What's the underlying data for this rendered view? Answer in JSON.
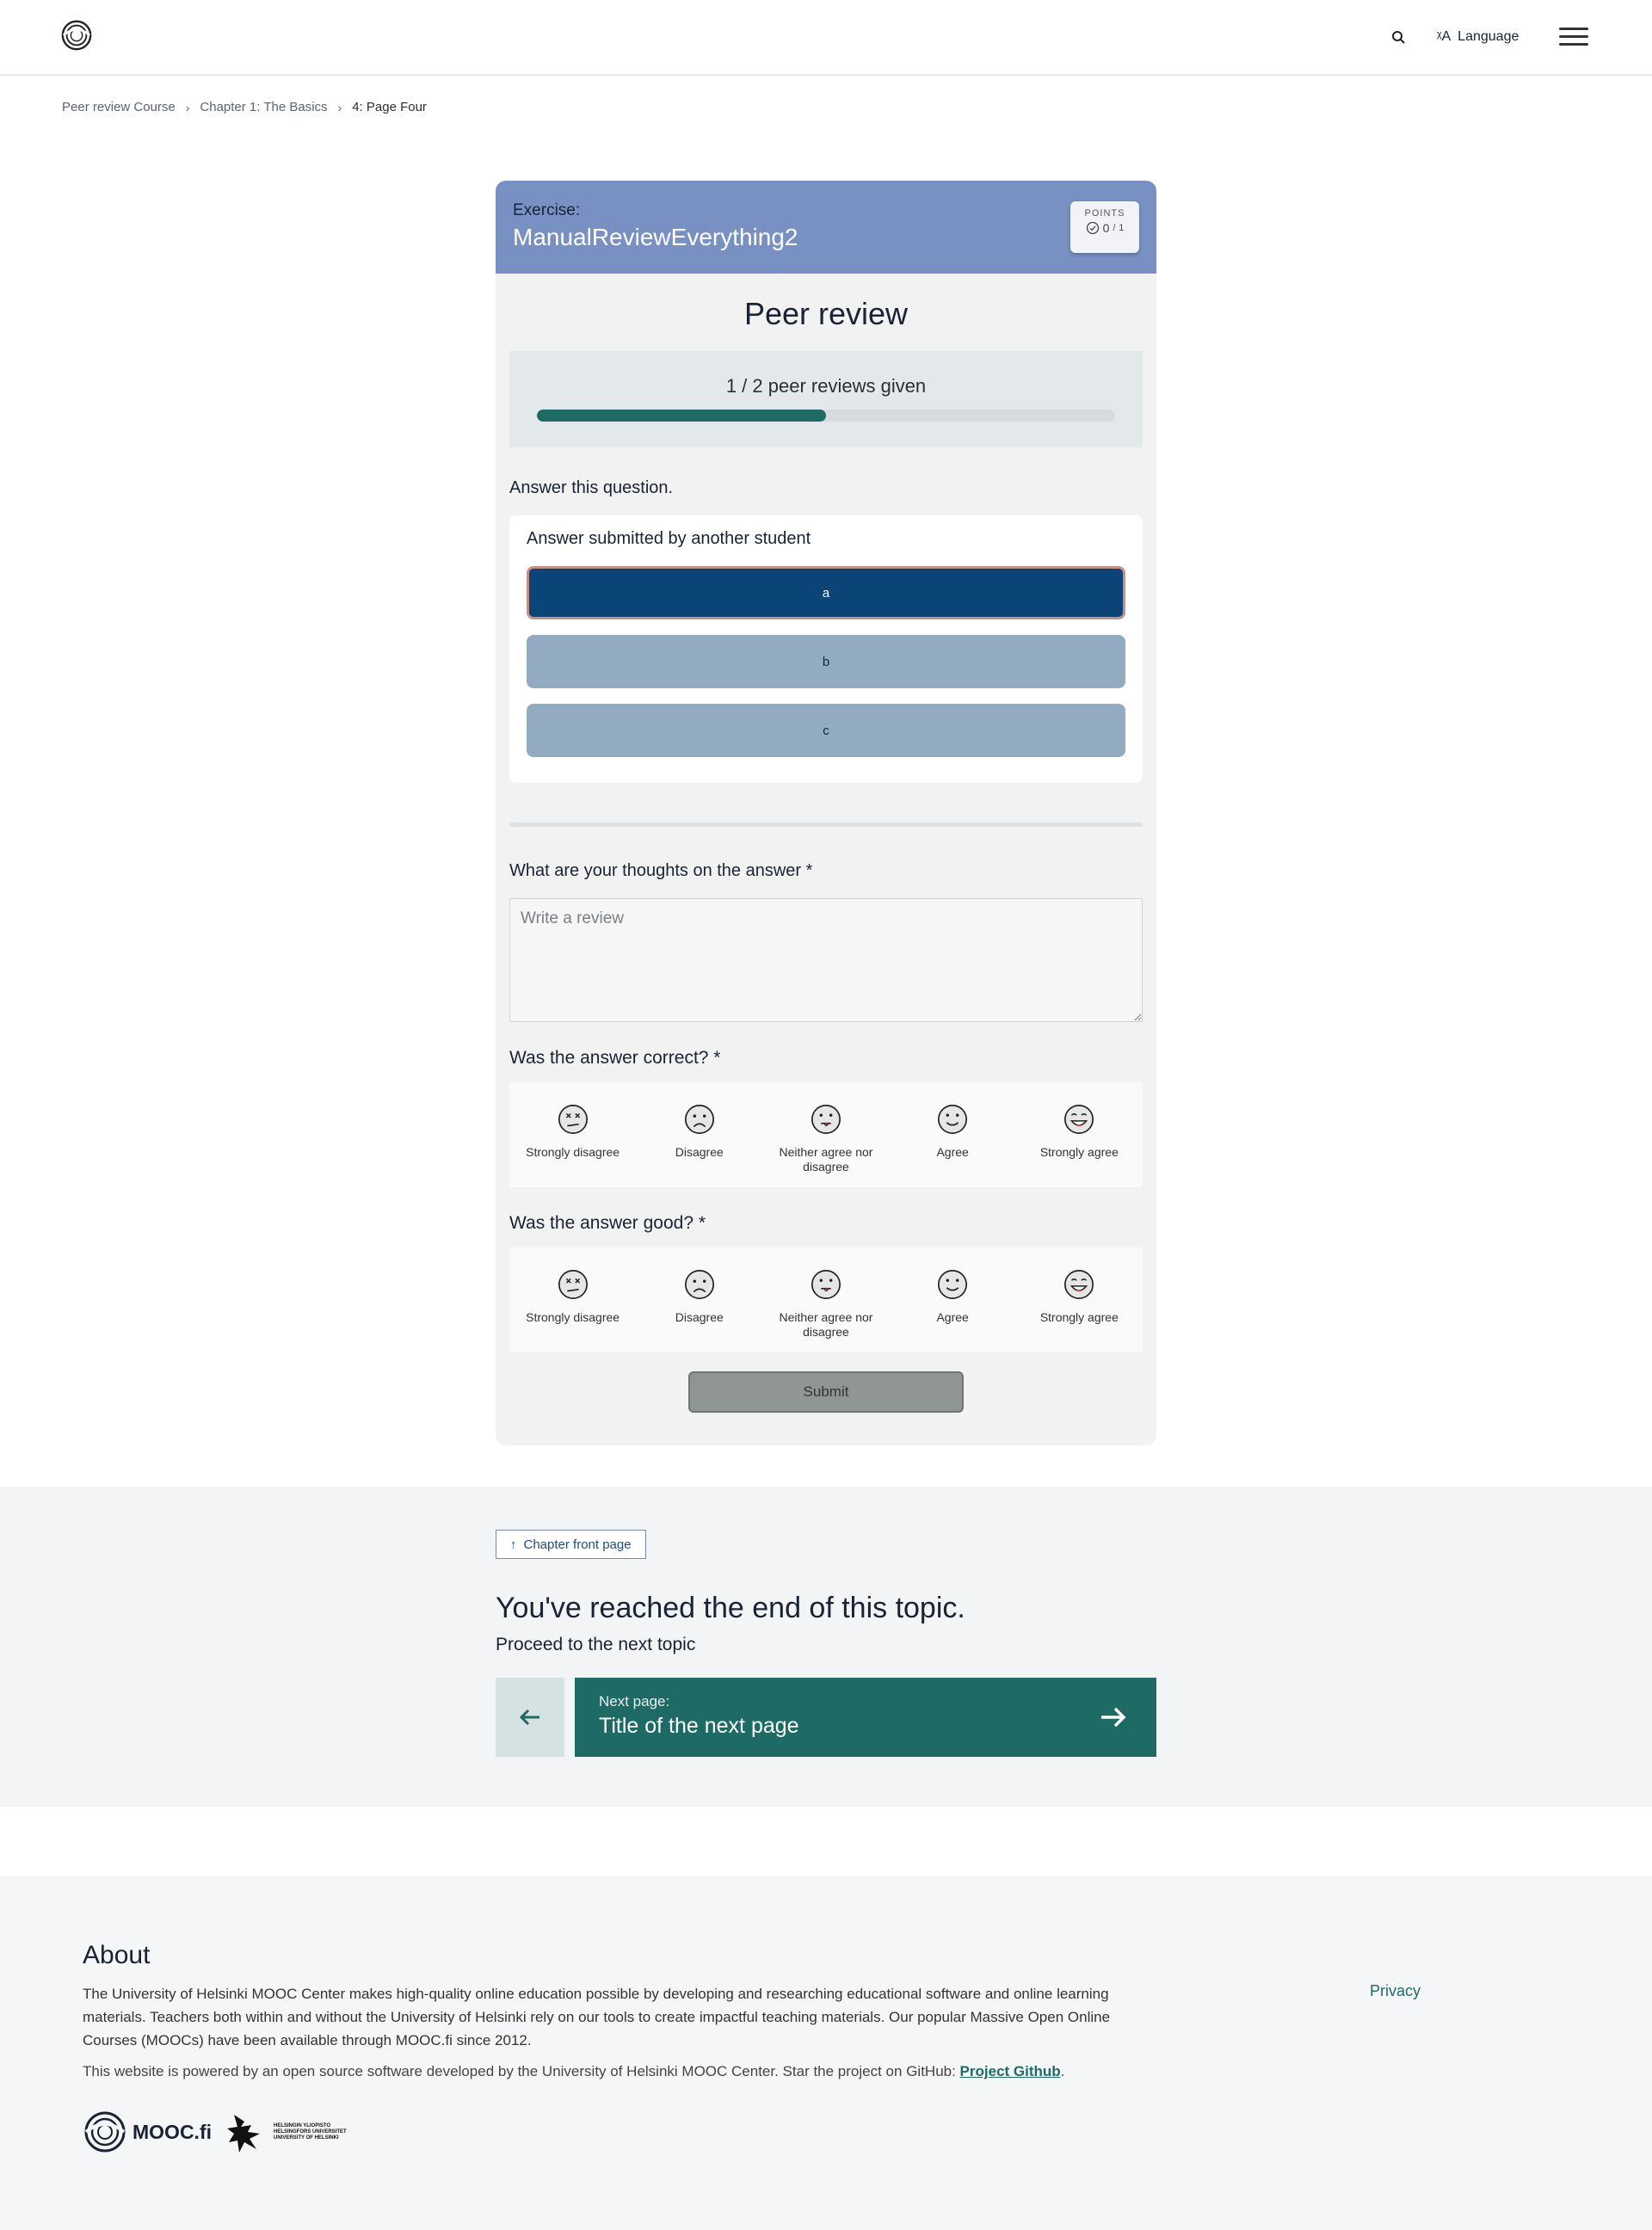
{
  "header": {
    "language_label": "Language"
  },
  "breadcrumb": [
    {
      "label": "Peer review Course"
    },
    {
      "label": "Chapter 1: The Basics"
    },
    {
      "label": "4: Page Four"
    }
  ],
  "exercise": {
    "label": "Exercise:",
    "name": "ManualReviewEverything2",
    "points_label": "POINTS",
    "points_value": "0",
    "points_max": "1"
  },
  "peer_review": {
    "title": "Peer review",
    "progress_text": "1 / 2 peer reviews given",
    "progress_fraction": 0.5,
    "question": "Answer this question.",
    "answer_heading": "Answer submitted by another student",
    "options": [
      {
        "label": "a",
        "selected": true
      },
      {
        "label": "b",
        "selected": false
      },
      {
        "label": "c",
        "selected": false
      }
    ],
    "thoughts_label": "What are your thoughts on the answer *",
    "review_placeholder": "Write a review",
    "correct_label": "Was the answer correct? *",
    "good_label": "Was the answer good? *",
    "likert": [
      {
        "label": "Strongly disagree",
        "icon": "strongly-disagree-face-icon"
      },
      {
        "label": "Disagree",
        "icon": "disagree-face-icon"
      },
      {
        "label": "Neither agree nor disagree",
        "icon": "neutral-face-icon"
      },
      {
        "label": "Agree",
        "icon": "agree-face-icon"
      },
      {
        "label": "Strongly agree",
        "icon": "strongly-agree-face-icon"
      }
    ],
    "submit_label": "Submit"
  },
  "topic_end": {
    "chapter_button": "Chapter front page",
    "title": "You've reached the end of this topic.",
    "subtitle": "Proceed to the next topic",
    "next_label": "Next page:",
    "next_title": "Title of the next page"
  },
  "footer": {
    "about_title": "About",
    "about_text": "The University of Helsinki MOOC Center makes high-quality online education possible by developing and researching educational software and online learning materials. Teachers both within and without the University of Helsinki rely on our tools to create impactful teaching materials. Our popular Massive Open Online Courses (MOOCs) have been available through MOOC.fi since 2012.",
    "powered_text": "This website is powered by an open source software developed by the University of Helsinki MOOC Center. Star the project on GitHub: ",
    "github_link": "Project Github",
    "privacy": "Privacy",
    "mooc_logo_text": "MOOC.fi",
    "uh_logo_lines": [
      "HELSINGIN YLIOPISTO",
      "HELSINGFORS UNIVERSITET",
      "UNIVERSITY OF HELSINKI"
    ]
  },
  "colors": {
    "accent": "#1e6b66",
    "exercise_header": "#7891c2",
    "selected_option": "#0b4477",
    "option": "#92abc0"
  }
}
